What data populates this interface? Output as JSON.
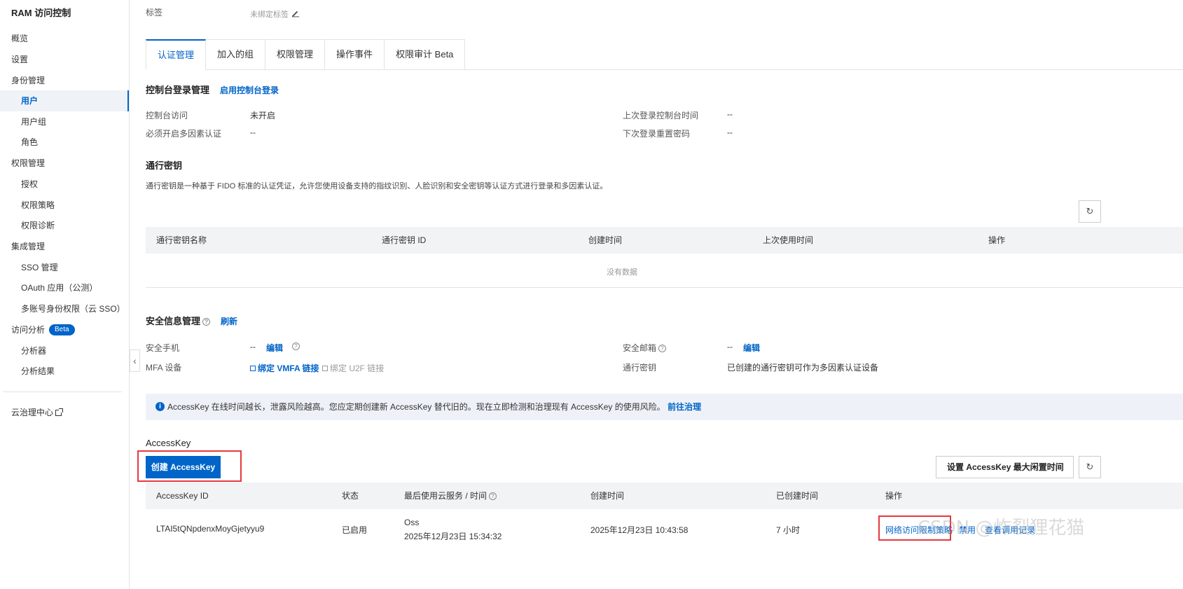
{
  "sidebar": {
    "title": "RAM 访问控制",
    "items": [
      {
        "label": "概览"
      },
      {
        "label": "设置"
      },
      {
        "label": "身份管理"
      },
      {
        "label": "用户"
      },
      {
        "label": "用户组"
      },
      {
        "label": "角色"
      },
      {
        "label": "权限管理"
      },
      {
        "label": "授权"
      },
      {
        "label": "权限策略"
      },
      {
        "label": "权限诊断"
      },
      {
        "label": "集成管理"
      },
      {
        "label": "SSO 管理"
      },
      {
        "label": "OAuth 应用（公测）"
      },
      {
        "label": "多账号身份权限（云 SSO）"
      },
      {
        "label": "访问分析"
      },
      {
        "label": "分析器"
      },
      {
        "label": "分析结果"
      },
      {
        "label": "云治理中心"
      }
    ],
    "beta_badge": "Beta"
  },
  "tag_row": {
    "label": "标签",
    "value": "未绑定标签"
  },
  "tabs": [
    {
      "label": "认证管理"
    },
    {
      "label": "加入的组"
    },
    {
      "label": "权限管理"
    },
    {
      "label": "操作事件"
    },
    {
      "label": "权限审计 Beta"
    }
  ],
  "console": {
    "title": "控制台登录管理",
    "action": "启用控制台登录",
    "access_label": "控制台访问",
    "access_value": "未开启",
    "mfa_label": "必须开启多因素认证",
    "mfa_value": "--",
    "last_login_label": "上次登录控制台时间",
    "last_login_value": "--",
    "reset_pwd_label": "下次登录重置密码",
    "reset_pwd_value": "--"
  },
  "passkey": {
    "title": "通行密钥",
    "desc": "通行密钥是一种基于 FIDO 标准的认证凭证，允许您使用设备支持的指纹识别、人脸识别和安全密钥等认证方式进行登录和多因素认证。",
    "columns": [
      "通行密钥名称",
      "通行密钥 ID",
      "创建时间",
      "上次使用时间",
      "操作"
    ],
    "empty": "没有数据"
  },
  "security": {
    "title": "安全信息管理",
    "refresh": "刷新",
    "phone_label": "安全手机",
    "phone_value": "--",
    "phone_edit": "编辑",
    "email_label": "安全邮箱",
    "email_value": "--",
    "email_edit": "编辑",
    "mfa_label": "MFA 设备",
    "bind_vmfa": "绑定 VMFA 链接",
    "bind_u2f": "绑定 U2F 链接",
    "passkey_label": "通行密钥",
    "passkey_value": "已创建的通行密钥可作为多因素认证设备"
  },
  "notice": {
    "text": "AccessKey 在线时间越长，泄露风险越高。您应定期创建新 AccessKey 替代旧的。现在立即检测和治理现有 AccessKey 的使用风险。",
    "link": "前往治理"
  },
  "accesskey": {
    "title": "AccessKey",
    "create_button": "创建 AccessKey",
    "idle_button": "设置 AccessKey 最大闲置时间",
    "warn_mark": "!",
    "columns": [
      "AccessKey ID",
      "状态",
      "最后使用云服务 / 时间",
      "创建时间",
      "已创建时间",
      "操作"
    ],
    "rows": [
      {
        "id": "LTAI5tQNpdenxMoyGjetyyu9",
        "status": "已启用",
        "last_service": "Oss",
        "last_time": "2025年12月23日 15:34:32",
        "created": "2025年12月23日 10:43:58",
        "age": "7 小时",
        "action_network": "网络访问限制策略",
        "action_disable": "禁用",
        "action_more": "查看调用记录"
      }
    ]
  },
  "watermark": "CSDN @炸裂狸花猫",
  "icons": {
    "refresh": "refresh-icon",
    "help": "help-icon",
    "info": "info-icon",
    "edit": "edit-icon",
    "external": "external-link-icon",
    "collapse": "chevron-left-icon"
  },
  "colors": {
    "accent": "#0064c8",
    "highlight": "#e8383d"
  }
}
